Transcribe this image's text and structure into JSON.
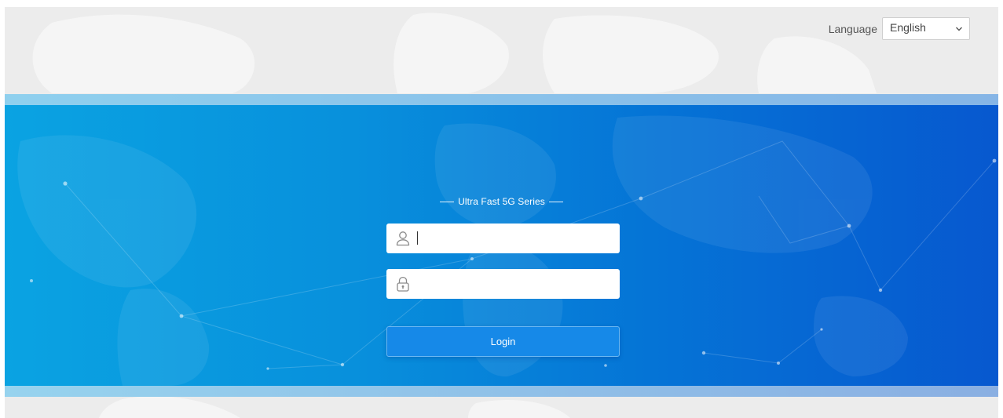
{
  "header": {
    "language_label": "Language",
    "language_selected": "English"
  },
  "login": {
    "series_title": "Ultra Fast 5G Series",
    "username_value": "",
    "password_value": "",
    "login_label": "Login"
  },
  "icons": {
    "username": "user-icon",
    "password": "lock-icon",
    "dropdown": "chevron-down-icon"
  },
  "colors": {
    "band_start": "#0aa3e2",
    "band_end": "#0758cf",
    "login_button": "#1689e8"
  }
}
